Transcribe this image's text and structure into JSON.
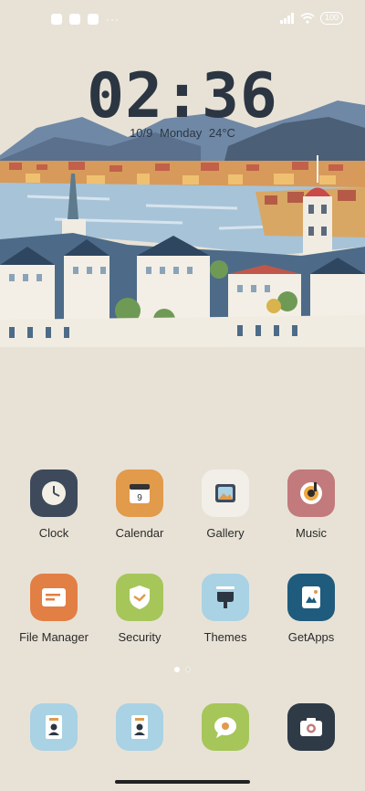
{
  "status_bar": {
    "battery": "100",
    "left_icons": [
      "app-notification-icon",
      "square-icon",
      "text-icon"
    ],
    "right_icons": [
      "signal-icon",
      "wifi-icon",
      "battery-icon"
    ]
  },
  "clock": {
    "time": "02:36",
    "date": "10/9",
    "weekday": "Monday",
    "temperature": "24°C"
  },
  "apps": [
    {
      "label": "Clock",
      "icon": "clock-icon",
      "color": "#3e4a5c"
    },
    {
      "label": "Calendar",
      "icon": "calendar-icon",
      "color": "#e29a4b"
    },
    {
      "label": "Gallery",
      "icon": "gallery-icon",
      "color": "#f2efe8"
    },
    {
      "label": "Music",
      "icon": "music-icon",
      "color": "#c27a7c"
    },
    {
      "label": "File Manager",
      "icon": "file-manager-icon",
      "color": "#e27f45"
    },
    {
      "label": "Security",
      "icon": "security-icon",
      "color": "#a6c65a"
    },
    {
      "label": "Themes",
      "icon": "themes-icon",
      "color": "#a9d2e4"
    },
    {
      "label": "GetApps",
      "icon": "getapps-icon",
      "color": "#1f5b7d"
    }
  ],
  "dock": [
    {
      "icon": "contacts-icon",
      "color": "#a9d2e4"
    },
    {
      "icon": "contacts-icon",
      "color": "#a9d2e4"
    },
    {
      "icon": "messaging-icon",
      "color": "#a6c65a"
    },
    {
      "icon": "camera-icon",
      "color": "#2e3a46"
    }
  ],
  "page_indicator": {
    "current": 1,
    "total": 2
  }
}
